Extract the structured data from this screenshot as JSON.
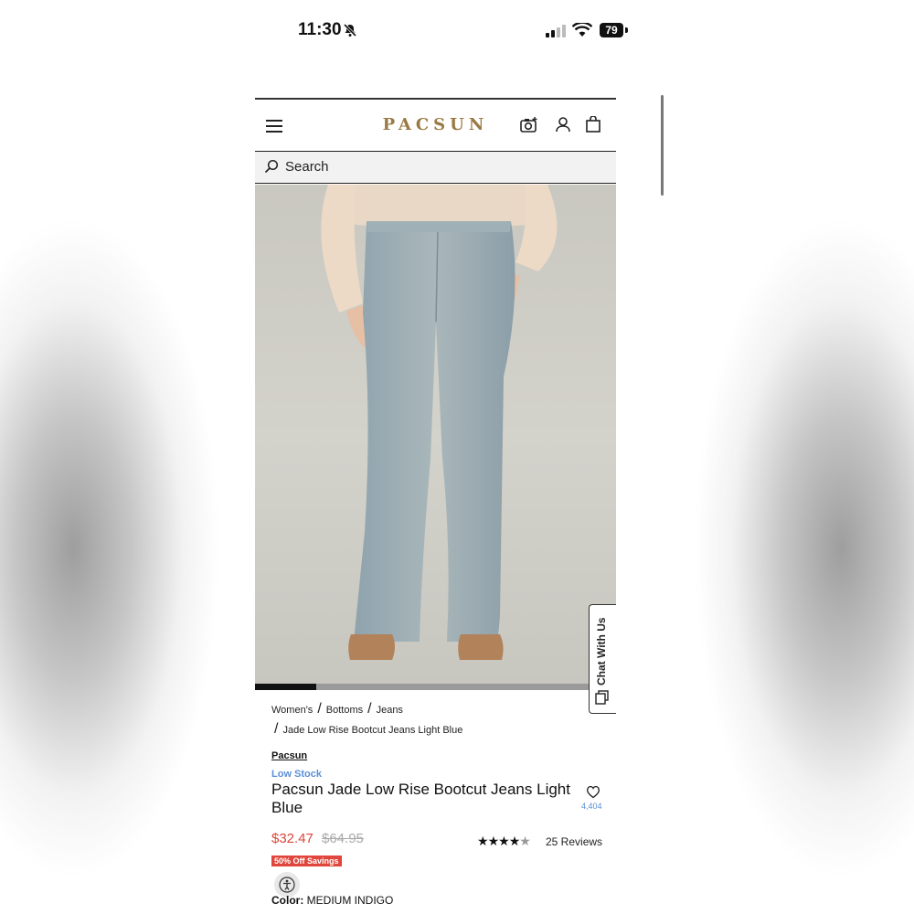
{
  "status": {
    "time": "11:30",
    "battery": "79"
  },
  "header": {
    "logo": "PACSUN"
  },
  "search": {
    "placeholder": "Search"
  },
  "gallery": {
    "progress_fraction": 0.17
  },
  "chat": {
    "label": "Chat With Us"
  },
  "breadcrumb": {
    "items": [
      "Women's",
      "Bottoms",
      "Jeans"
    ],
    "current": "Jade Low Rise Bootcut Jeans Light Blue"
  },
  "product": {
    "brand": "Pacsun",
    "stock": "Low Stock",
    "title": "Pacsun Jade Low Rise Bootcut Jeans Light Blue",
    "wishlist_count": "4,404",
    "price": "$32.47",
    "original_price": "$64.95",
    "rating": 4.5,
    "reviews": "25 Reviews",
    "savings_badge": "50% Off Savings",
    "color_label": "Color:",
    "color_value": "MEDIUM INDIGO"
  },
  "colors": {
    "brand_gold": "#9a7a44",
    "sale_red": "#d9473a",
    "link_blue": "#5b8fd6"
  }
}
